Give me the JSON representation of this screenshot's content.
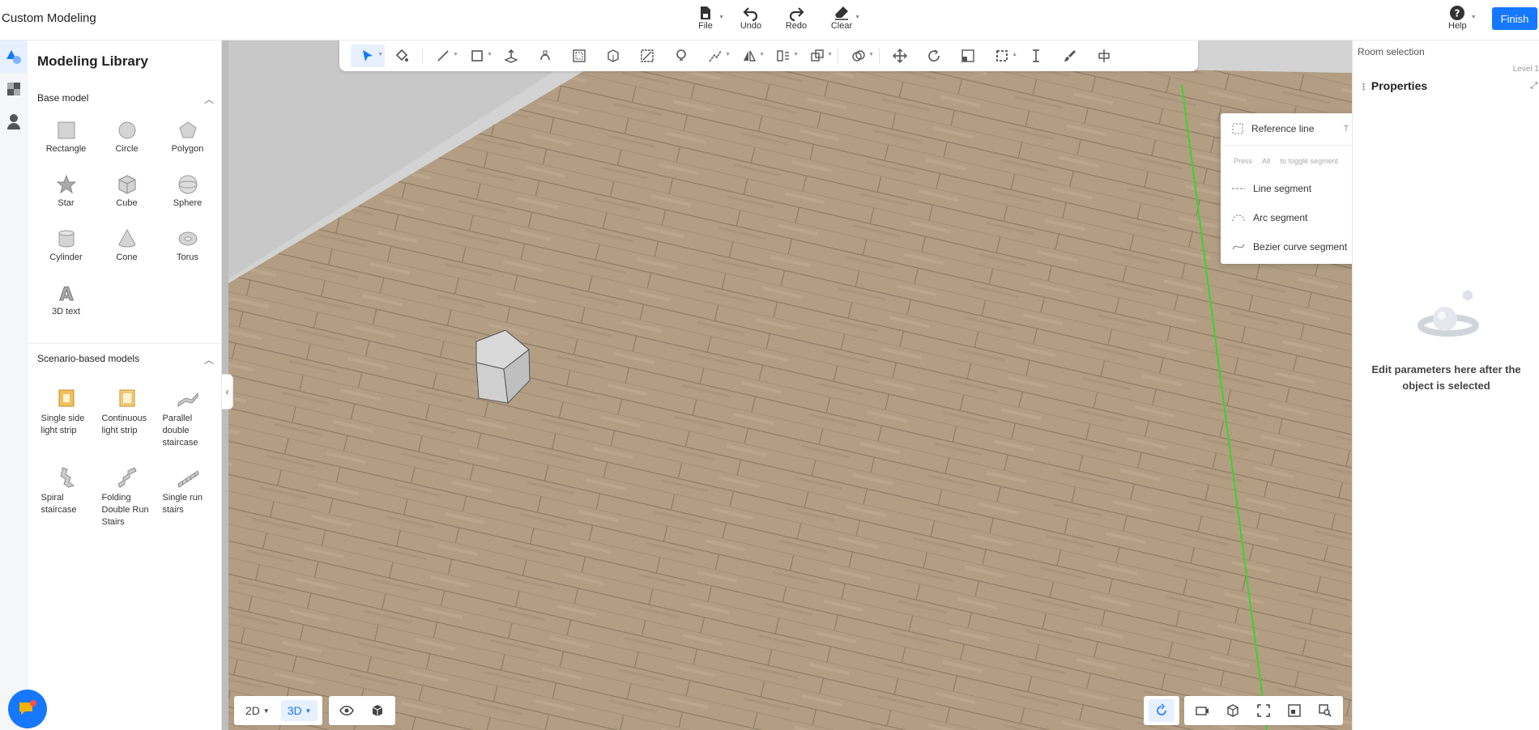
{
  "app": {
    "title": "Custom Modeling"
  },
  "header": {
    "file": "File",
    "undo": "Undo",
    "redo": "Redo",
    "clear": "Clear",
    "help": "Help",
    "finish": "Finish"
  },
  "library": {
    "title": "Modeling Library",
    "base_model": {
      "heading": "Base model",
      "items": [
        "Rectangle",
        "Circle",
        "Polygon",
        "Star",
        "Cube",
        "Sphere",
        "Cylinder",
        "Cone",
        "Torus",
        "3D text"
      ]
    },
    "scenario": {
      "heading": "Scenario-based models",
      "items": [
        "Single side light strip",
        "Continuous light strip",
        "Parallel double staircase",
        "Spiral staircase",
        "Folding Double Run Stairs",
        "Single run stairs"
      ]
    }
  },
  "dropdown": {
    "reference_line": "Reference line",
    "reference_key": "T",
    "hint_press": "Press",
    "hint_key": "Alt",
    "hint_text": "to toggle segment",
    "line_segment": "Line segment",
    "arc_segment": "Arc segment",
    "bezier_segment": "Bezier curve segment"
  },
  "view": {
    "mode_2d": "2D",
    "mode_3d": "3D"
  },
  "properties": {
    "room_selection": "Room selection",
    "level": "Level 1",
    "title": "Properties",
    "empty_line1": "Edit parameters here after the",
    "empty_line2": "object is selected"
  },
  "colors": {
    "accent": "#1677ff",
    "floor": "#b39e84",
    "guide_line": "#3cd22a"
  }
}
